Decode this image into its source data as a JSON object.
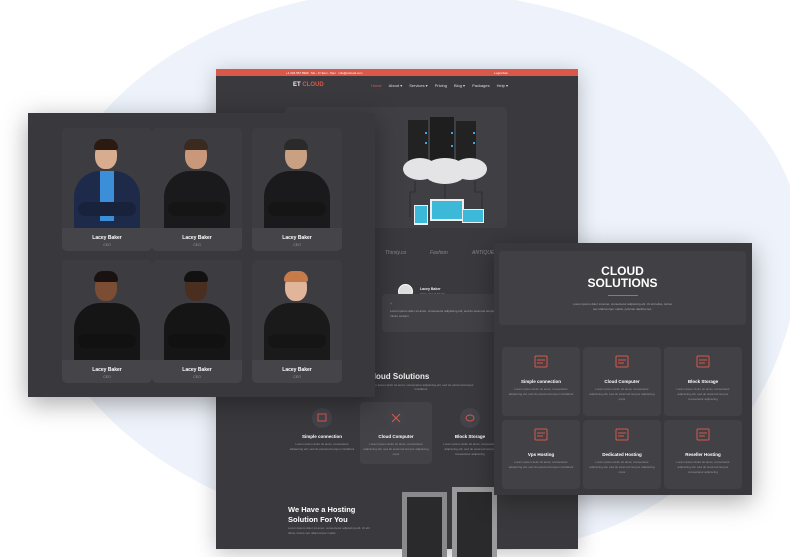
{
  "topbar": {
    "phone": "+1 234 567 8900",
    "email": "Mo - Fr 9am - 5pm",
    "mail": "info@etcloud.com",
    "login": "Login/Join"
  },
  "nav": {
    "logo_a": "ET",
    "logo_b": "CLOUD",
    "items": [
      "Home",
      "About ▾",
      "Services ▾",
      "Pricing",
      "Blog ▾",
      "Packages",
      "Help ▾"
    ]
  },
  "logos": [
    "Thirsty.co",
    "Fashion",
    "ANTIQUE"
  ],
  "testimonial": {
    "name": "Lacey Baker",
    "role": "CEO, Cloud Studio",
    "quote_mark": "“",
    "text": "Lorem ipsum dolor sit amet, consectetur adipiscing elit, sed do eiusmod tempor incididunt ut labore et dolore magna aliqua. Ut enim ad minim veniam."
  },
  "services": {
    "title": "Cloud Solutions",
    "subtitle": "Lorem ipsum dolor sit amet, consectetur adipiscing elit, sed do eiusmod tempor incididunt",
    "items": [
      {
        "title": "Simple connection",
        "text": "Lorem ipsum dolor sit amet, consectetur adipiscing elit, sed do eiusmod tempor incididunt"
      },
      {
        "title": "Cloud Computer",
        "text": "Lorem ipsum dolor sit amet, consectetur adipiscing elit, sed do eiusmod tempor adipiscing mpor"
      },
      {
        "title": "Block Storage",
        "text": "Lorem ipsum dolor sit amet, consectetur adipiscing elit, sed do eiusmod tempor consectetur adipiscing"
      }
    ]
  },
  "hosting": {
    "title_1": "We Have a Hosting",
    "title_2": "Solution For You",
    "text": "Lorem ipsum dolor sit amet, consectetur adipiscing elit. Ut elit tellus, luctus nec ullamcorper mattis."
  },
  "team": [
    {
      "name": "Lacey Baker",
      "role": "CEO"
    },
    {
      "name": "Lacey Baker",
      "role": "CEO"
    },
    {
      "name": "Lacey Baker",
      "role": "CEO"
    },
    {
      "name": "Lacey Baker",
      "role": "CEO"
    },
    {
      "name": "Lacey Baker",
      "role": "CEO"
    },
    {
      "name": "Lacey Baker",
      "role": "CEO"
    }
  ],
  "cloud_panel": {
    "title_1": "CLOUD",
    "title_2": "SOLUTIONS",
    "text": "Lorem ipsum dolor sit amet, consectetur adipiscing elit. Ut elit tellus, luctus nec ullamcorper mattis, pulvinar dapibus leo.",
    "cards": [
      {
        "title": "Simple connection",
        "text": "Lorem ipsum dolor sit amet, consectetur adipiscing elit, sed do eiusmod tempor incididunt"
      },
      {
        "title": "Cloud Computer",
        "text": "Lorem ipsum dolor sit amet, consectetur adipiscing elit, sed do eiusmod tempor adipiscing mpor"
      },
      {
        "title": "Block Storage",
        "text": "Lorem ipsum dolor sit amet, consectetur adipiscing elit, sed do eiusmod tempor consectetur adipiscing"
      },
      {
        "title": "Vps Hosting",
        "text": "Lorem ipsum dolor sit amet, consectetur adipiscing elit, sed do eiusmod tempor incididunt"
      },
      {
        "title": "Dedicated Hosting",
        "text": "Lorem ipsum dolor sit amet, consectetur adipiscing elit, sed do eiusmod tempor adipiscing mpor"
      },
      {
        "title": "Reseller Hosting",
        "text": "Lorem ipsum dolor sit amet, consectetur adipiscing elit, sed do eiusmod tempor consectetur adipiscing"
      }
    ]
  },
  "colors": {
    "accent": "#d9584a",
    "panel": "#39383c",
    "card": "#424146"
  }
}
